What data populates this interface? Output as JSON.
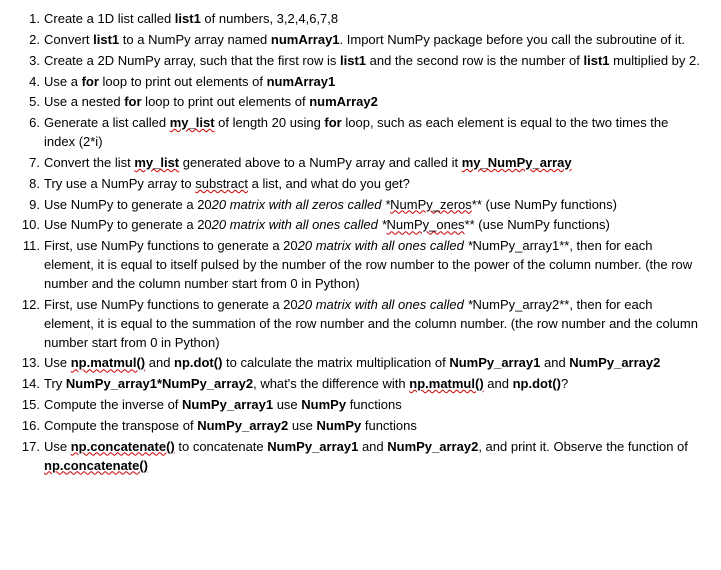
{
  "items": [
    {
      "prefix": "Create a 1D list called ",
      "b1": "list1",
      "suffix": " of numbers, 3,2,4,6,7,8"
    },
    {
      "prefix": "Convert ",
      "b1": "list1",
      "mid1": " to a NumPy array named ",
      "b2": "numArray1",
      "suffix": ". Import NumPy package before you call the subroutine of it."
    },
    {
      "prefix": "Create a 2D NumPy array, such that the first row is ",
      "b1": "list1",
      "mid1": " and the second row is the number of ",
      "b2": "list1",
      "suffix": " multiplied by 2."
    },
    {
      "prefix": "Use a ",
      "b1": "for",
      "mid1": " loop to print out elements of ",
      "b2": "numArray1"
    },
    {
      "prefix": "Use a nested ",
      "b1": "for",
      "mid1": " loop to print out elements of ",
      "b2": "numArray2"
    },
    {
      "prefix": "Generate a list called ",
      "m1": "my_list",
      "mid1": " of length 20 using ",
      "b1": "for",
      "suffix": " loop, such as each element is equal to the two times the index (2*i)"
    },
    {
      "prefix": "Convert the list ",
      "m1": "my_list",
      "mid1": " generated above to a NumPy array and called it ",
      "m2": "my_NumPy_array"
    },
    {
      "prefix": "Try use a NumPy array to ",
      "m1": "substract",
      "suffix": " a list, and what do you get?"
    },
    {
      "prefix": "Use NumPy to generate a 20",
      "it1": "20 matrix with all zeros called *",
      "m1": "NumPy_zeros",
      "suffix": "** (use NumPy functions)"
    },
    {
      "prefix": "Use NumPy to generate a 20",
      "it1": "20 matrix with all ones called *",
      "m1": "NumPy_ones",
      "suffix": "** (use NumPy functions)"
    },
    {
      "prefix": "First, use NumPy functions to generate a 20",
      "it1": "20 matrix with all ones called *",
      "suffix": "NumPy_array1**, then for each element, it is equal to itself pulsed by the number of the row number to the power of the column number. (the row number and the column number start from 0 in Python)"
    },
    {
      "prefix": "First, use NumPy functions to generate a 20",
      "it1": "20 matrix with all ones called *",
      "suffix": "NumPy_array2**, then for each element, it is equal to the summation of the row number and the column number. (the row number and the column number start from 0 in Python)"
    },
    {
      "prefix": "Use ",
      "bm1": "np.matmul()",
      "mid1": " and ",
      "b1": "np.dot()",
      "mid2": " to calculate the matrix multiplication of ",
      "b2": "NumPy_array1",
      "mid3": " and ",
      "b3": "NumPy_array2"
    },
    {
      "prefix": "Try ",
      "b1": "NumPy_array1*NumPy_array2",
      "mid1": ", what's the difference with ",
      "bm1": "np.matmul()",
      "mid2": " and ",
      "b2": "np.dot()",
      "suffix": "?"
    },
    {
      "prefix": "Compute the inverse of ",
      "b1": "NumPy_array1",
      "mid1": " use ",
      "b2": "NumPy",
      "suffix": " functions"
    },
    {
      "prefix": "Compute the transpose of ",
      "b1": "NumPy_array2",
      "mid1": " use ",
      "b2": "NumPy",
      "suffix": " functions"
    },
    {
      "prefix": "Use ",
      "bm1": "np.concatenate()",
      "mid1": " to concatenate ",
      "b1": "NumPy_array1",
      "mid2": " and ",
      "b2": "NumPy_array2",
      "mid3": ", and print it. Observe the function of ",
      "bm2": "np.concatenate()"
    }
  ]
}
